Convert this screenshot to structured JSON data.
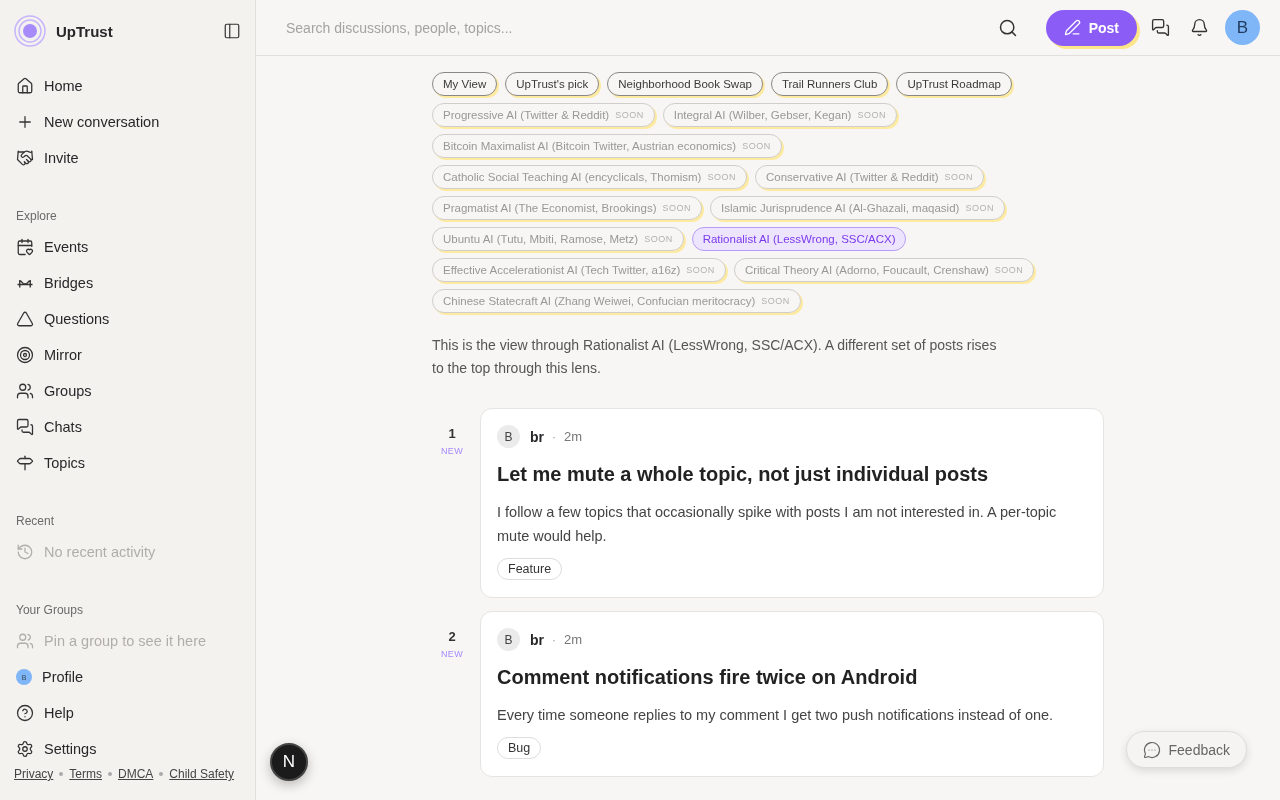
{
  "app": {
    "name": "UpTrust"
  },
  "sidebar": {
    "top_items": [
      {
        "label": "Home",
        "kind": "link"
      },
      {
        "label": "New conversation",
        "kind": "link"
      },
      {
        "label": "Invite",
        "kind": "link"
      }
    ],
    "sections": [
      {
        "title": "Explore",
        "items": [
          {
            "label": "Events",
            "kind": "link"
          },
          {
            "label": "Bridges",
            "kind": "link"
          },
          {
            "label": "Questions",
            "kind": "link"
          },
          {
            "label": "Mirror",
            "kind": "link"
          },
          {
            "label": "Groups",
            "kind": "link"
          },
          {
            "label": "Chats",
            "kind": "link"
          },
          {
            "label": "Topics",
            "kind": "link"
          }
        ]
      },
      {
        "title": "Recent",
        "items": [
          {
            "label": "No recent activity",
            "kind": "empty"
          }
        ]
      },
      {
        "title": "Your Groups",
        "items": [
          {
            "label": "Pin a group to see it here",
            "kind": "empty"
          }
        ]
      }
    ],
    "bottom_items": [
      {
        "label": "Profile",
        "kind": "avatar",
        "avatar": "B"
      },
      {
        "label": "Help",
        "kind": "link"
      },
      {
        "label": "Settings",
        "kind": "link"
      }
    ],
    "footer_links": [
      "Privacy",
      "Terms",
      "DMCA",
      "Child Safety"
    ]
  },
  "header": {
    "search": {
      "placeholder": "Search discussions, people, topics..."
    },
    "post_button": "Post",
    "avatar": "B"
  },
  "lenses": [
    {
      "label": "My View",
      "selected": false,
      "disabled": false
    },
    {
      "label": "UpTrust's pick",
      "selected": false,
      "disabled": false
    },
    {
      "label": "Neighborhood Book Swap",
      "selected": false,
      "disabled": false
    },
    {
      "label": "Trail Runners Club",
      "selected": false,
      "disabled": false
    },
    {
      "label": "UpTrust Roadmap",
      "selected": false,
      "disabled": false
    },
    {
      "label": "Progressive AI (Twitter & Reddit)",
      "soon": "SOON",
      "selected": false,
      "disabled": true
    },
    {
      "label": "Integral AI (Wilber, Gebser, Kegan)",
      "soon": "SOON",
      "selected": false,
      "disabled": true
    },
    {
      "label": "Bitcoin Maximalist AI (Bitcoin Twitter, Austrian economics)",
      "soon": "SOON",
      "selected": false,
      "disabled": true
    },
    {
      "label": "Catholic Social Teaching AI (encyclicals, Thomism)",
      "soon": "SOON",
      "selected": false,
      "disabled": true
    },
    {
      "label": "Conservative AI (Twitter & Reddit)",
      "soon": "SOON",
      "selected": false,
      "disabled": true
    },
    {
      "label": "Pragmatist AI (The Economist, Brookings)",
      "soon": "SOON",
      "selected": false,
      "disabled": true
    },
    {
      "label": "Islamic Jurisprudence AI (Al-Ghazali, maqasid)",
      "soon": "SOON",
      "selected": false,
      "disabled": true
    },
    {
      "label": "Ubuntu AI (Tutu, Mbiti, Ramose, Metz)",
      "soon": "SOON",
      "selected": false,
      "disabled": true
    },
    {
      "label": "Rationalist AI (LessWrong, SSC/ACX)",
      "selected": true,
      "disabled": false
    },
    {
      "label": "Effective Accelerationist AI (Tech Twitter, a16z)",
      "soon": "SOON",
      "selected": false,
      "disabled": true
    },
    {
      "label": "Critical Theory AI (Adorno, Foucault, Crenshaw)",
      "soon": "SOON",
      "selected": false,
      "disabled": true
    },
    {
      "label": "Chinese Statecraft AI (Zhang Weiwei, Confucian meritocracy)",
      "soon": "SOON",
      "selected": false,
      "disabled": true
    }
  ],
  "lens_description": "This is the view through Rationalist AI (LessWrong, SSC/ACX). A different set of posts rises to the top through this lens.",
  "posts": [
    {
      "rank": "1",
      "badge": "NEW",
      "avatar": "B",
      "author": "br",
      "separator": "·",
      "time": "2m",
      "title": "Let me mute a whole topic, not just individual posts",
      "body": "I follow a few topics that occasionally spike with posts I am not interested in. A per-topic mute would help.",
      "tag": "Feature"
    },
    {
      "rank": "2",
      "badge": "NEW",
      "avatar": "B",
      "author": "br",
      "separator": "·",
      "time": "2m",
      "title": "Comment notifications fire twice on Android",
      "body": "Every time someone replies to my comment I get two push notifications instead of one.",
      "tag": "Bug"
    }
  ],
  "feedback_button": "Feedback",
  "dev_badge": "N"
}
